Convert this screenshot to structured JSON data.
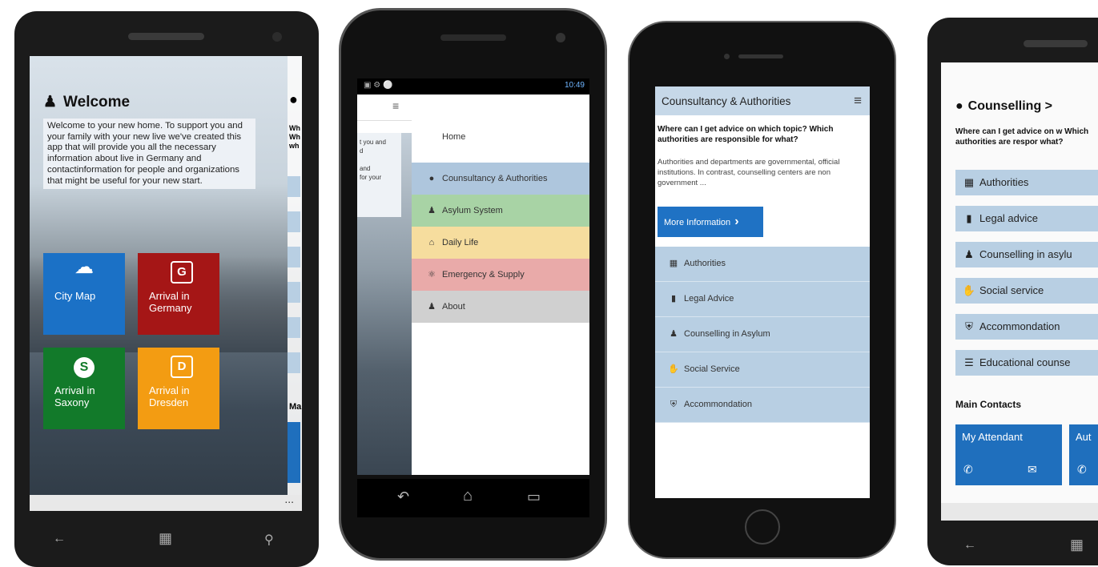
{
  "phone1": {
    "title": "Welcome",
    "intro": "Welcome to your new home. To support you and your family with your new live we've created this app that will provide you all the necessary information about live in Germany and contactinformation for people and organizations that might be useful for your new start.",
    "tiles": [
      {
        "label": "City Map",
        "icon": "map-icon",
        "glyph": "▞",
        "color": "#1b71c6"
      },
      {
        "label": "Arrival in Germany",
        "icon": "G",
        "glyph": "G",
        "color": "#a51616"
      },
      {
        "label": "Arrival in Saxony",
        "icon": "S",
        "glyph": "S",
        "color": "#127a2a"
      },
      {
        "label": "Arrival in Dresden",
        "icon": "D",
        "glyph": "D",
        "color": "#f39c12"
      }
    ],
    "peek_texts": [
      "Wh",
      "Wh",
      "wh"
    ],
    "peek_bottom": "Ma",
    "more": "..."
  },
  "phone2": {
    "status_time": "10:49",
    "menu": [
      {
        "label": "Home",
        "color": "#ffffff",
        "icon": "none"
      },
      {
        "label": "Counsultancy & Authorities",
        "color": "#aec6dd",
        "icon": "speech-bubble-icon"
      },
      {
        "label": "Asylum System",
        "color": "#a8d3a5",
        "icon": "person-icon"
      },
      {
        "label": "Daily Life",
        "color": "#f6dd9e",
        "icon": "home-icon"
      },
      {
        "label": "Emergency & Supply",
        "color": "#e9aaa9",
        "icon": "emergency-icon"
      },
      {
        "label": "About",
        "color": "#d0d0d0",
        "icon": "person-icon"
      }
    ],
    "peek_text": "t you and\nd\n\nand\nfor your"
  },
  "phone3": {
    "title": "Counsultancy & Authorities",
    "question": "Where can I get advice on which topic? Which authorities are responsible for what?",
    "body": "Authorities and departments are governmental, official institutions. In contrast, counselling centers are non government ...",
    "button": "More Information",
    "items": [
      "Authorities",
      "Legal Advice",
      "Counselling in Asylum",
      "Social Service",
      "Accommondation"
    ]
  },
  "phone4": {
    "title": "Counselling >",
    "question": "Where can I get advice on w Which authorities are respor what?",
    "items": [
      "Authorities",
      "Legal advice",
      "Counselling in asylu",
      "Social service",
      "Accommondation",
      "Educational counse"
    ],
    "contacts_title": "Main Contacts",
    "contacts": [
      "My Attendant",
      "Aut"
    ]
  }
}
